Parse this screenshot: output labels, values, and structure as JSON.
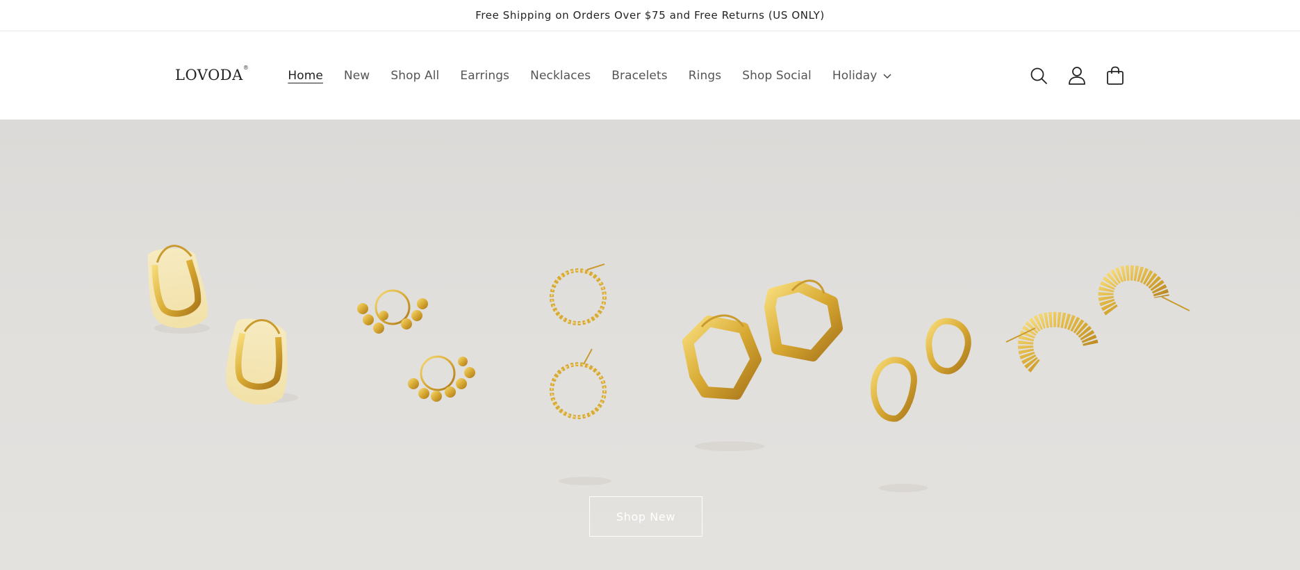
{
  "announcement": {
    "text": "Free Shipping on Orders Over $75 and Free Returns (US ONLY)"
  },
  "header": {
    "logo": "LOVODA",
    "nav": [
      {
        "label": "Home",
        "active": true
      },
      {
        "label": "New"
      },
      {
        "label": "Shop All"
      },
      {
        "label": "Earrings"
      },
      {
        "label": "Necklaces"
      },
      {
        "label": "Bracelets"
      },
      {
        "label": "Rings"
      },
      {
        "label": "Shop Social"
      },
      {
        "label": "Holiday",
        "dropdown": true
      }
    ],
    "icons": [
      "search-icon",
      "account-icon",
      "cart-icon"
    ]
  },
  "hero": {
    "button_label": "Shop New",
    "background_color": "#e1dfdc",
    "accent_gold": "#d8b247"
  }
}
